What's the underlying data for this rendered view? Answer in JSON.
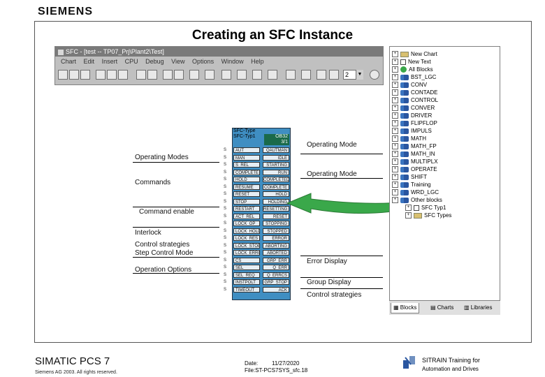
{
  "header": {
    "logo": "SIEMENS",
    "title": "Creating an SFC Instance"
  },
  "app": {
    "title": "SFC - [test -- TP07_Prj\\Plant2\\Test]",
    "menu": [
      "Chart",
      "Edit",
      "Insert",
      "CPU",
      "Debug",
      "View",
      "Options",
      "Window",
      "Help"
    ],
    "zoom": "2"
  },
  "block": {
    "header_line1": "SFC-Type",
    "header_line2": "SFC-Typ1",
    "header_right1": "OB32",
    "header_right2": "3/1",
    "inputs": [
      "AUT",
      "MAN",
      "S_REL",
      "COMPLETE",
      "HOLD",
      "RESUME",
      "RESET",
      "STOP",
      "RESTART",
      "ACT_REL",
      "LOCK_OP",
      "LOCK_HOLD",
      "LOCK_RES",
      "LOCK_STOP",
      "LOCK_ERROR",
      "CS",
      "SEL",
      "SEL_REQ",
      "INSTPOLT",
      "TIMEOUT"
    ],
    "outputs": [
      "QAUTMAN",
      "IDLE",
      "STARTING",
      "RUN",
      "COMPLETED",
      "COMPLETE",
      "HOLD",
      "HOLDING",
      "RESETTING",
      "RESET",
      "STOPPING",
      "STOPPED",
      "ERROR",
      "ABORTING",
      "ABORTED",
      "GRP_ERR",
      "Q_ERR",
      "Q_ERRCS",
      "GRP_STOP",
      "ACK"
    ],
    "ticks": [
      "S",
      "S",
      "S",
      "S",
      "S",
      "S",
      "S",
      "S",
      "S",
      "S",
      "S",
      "S",
      "S",
      "S",
      "S",
      "S",
      "S",
      "S",
      "S",
      "S"
    ]
  },
  "labels": {
    "left": [
      "Operating Modes",
      "Commands",
      "Command enable",
      "Interlock",
      "Control strategies",
      "Step Control Mode",
      "Operation Options"
    ],
    "right": [
      "Operating Mode",
      "Operating Mode",
      "Error Display",
      "Group Display",
      "Control strategies"
    ]
  },
  "tree": {
    "items": [
      {
        "label": "New Chart",
        "icon": "folder-icon"
      },
      {
        "label": "New Text",
        "icon": "doc-icon"
      },
      {
        "label": "All Blocks",
        "icon": "green-icon"
      },
      {
        "label": "BST_LGC",
        "icon": "net-icon"
      },
      {
        "label": "CONV",
        "icon": "net-icon"
      },
      {
        "label": "CONTADE",
        "icon": "net-icon"
      },
      {
        "label": "CONTROL",
        "icon": "net-icon"
      },
      {
        "label": "CONVER",
        "icon": "net-icon"
      },
      {
        "label": "DRIVER",
        "icon": "net-icon"
      },
      {
        "label": "FLIPFLOP",
        "icon": "net-icon"
      },
      {
        "label": "IMPULS",
        "icon": "net-icon"
      },
      {
        "label": "MATH",
        "icon": "net-icon"
      },
      {
        "label": "MATH_FP",
        "icon": "net-icon"
      },
      {
        "label": "MATH_IN",
        "icon": "net-icon"
      },
      {
        "label": "MULTIPLX",
        "icon": "net-icon"
      },
      {
        "label": "OPERATE",
        "icon": "net-icon"
      },
      {
        "label": "SHIFT",
        "icon": "net-icon"
      },
      {
        "label": "Training",
        "icon": "net-icon"
      },
      {
        "label": "WRD_LGC",
        "icon": "net-icon"
      },
      {
        "label": "Other blocks",
        "icon": "net-icon"
      },
      {
        "label": "SFC Typ1",
        "icon": "doc-icon"
      },
      {
        "label": "SFC Types",
        "icon": "folder-icon"
      }
    ],
    "tabs": [
      "Blocks",
      "Charts",
      "Libraries"
    ]
  },
  "footer": {
    "product": "SIMATIC PCS 7",
    "copyright": "Siemens AG 2003. All rights reserved.",
    "date_label": "Date:",
    "date_value": "11/27/2020",
    "file": "File:ST-PCS7SYS_sfc.18",
    "training_line1": "SITRAIN Training for",
    "training_line2": "Automation and Drives"
  },
  "colors": {
    "block_body": "#3f8ec2",
    "arrow": "#3aa84a",
    "titlebar": "#7a7a7a"
  }
}
